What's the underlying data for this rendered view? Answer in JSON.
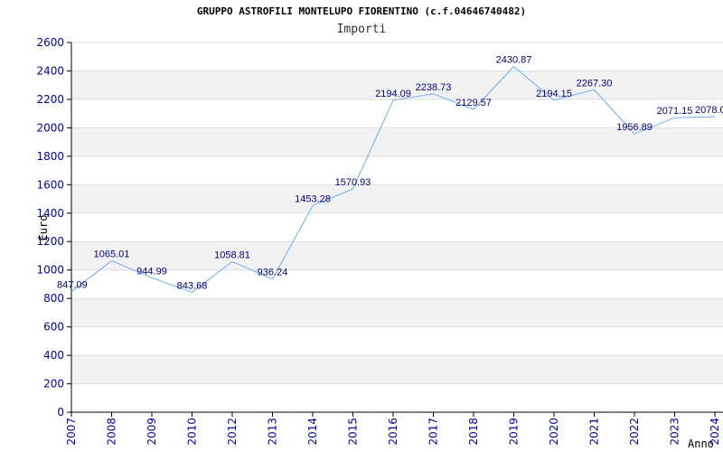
{
  "chart_data": {
    "type": "line",
    "title": "GRUPPO ASTROFILI MONTELUPO FIORENTINO (c.f.04646740482)",
    "subtitle": "Importi",
    "xlabel": "Anno",
    "ylabel": "Euro",
    "ylim": [
      0,
      2600
    ],
    "yticks": [
      0,
      200,
      400,
      600,
      800,
      1000,
      1200,
      1400,
      1600,
      1800,
      2000,
      2200,
      2400,
      2600
    ],
    "grid": true,
    "categories": [
      "2007",
      "2008",
      "2009",
      "2010",
      "2012",
      "2013",
      "2014",
      "2015",
      "2016",
      "2017",
      "2018",
      "2019",
      "2020",
      "2021",
      "2022",
      "2023",
      "2024"
    ],
    "values": [
      847.09,
      1065.01,
      944.99,
      843.68,
      1058.81,
      936.24,
      1453.28,
      1570.93,
      2194.09,
      2238.73,
      2129.57,
      2430.87,
      2194.15,
      2267.3,
      1956.89,
      2071.15,
      2078.0
    ],
    "labels": [
      "847.09",
      "1065.01",
      "944.99",
      "843.68",
      "1058.81",
      "936.24",
      "1453.28",
      "1570.93",
      "2194.09",
      "2238.73",
      "2129.57",
      "2430.87",
      "2194.15",
      "2267.30",
      "1956.89",
      "2071.15",
      "2078.0"
    ],
    "colors": {
      "line": "#6aaef0",
      "band": "#f2f2f2",
      "grid": "#dddddd",
      "tick": "#0000aa",
      "label": "#000080"
    }
  }
}
